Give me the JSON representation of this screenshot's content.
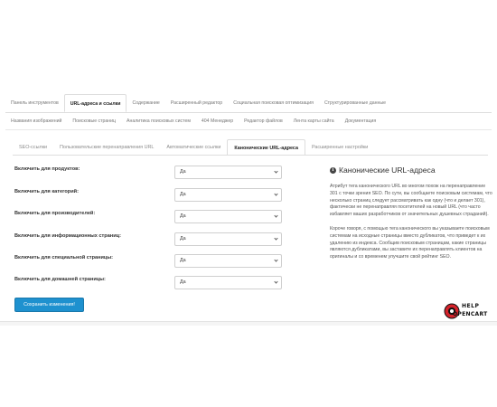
{
  "main_tabs": {
    "row1": [
      "Панель инструментов",
      "URL-адреса и ссылки",
      "Содержание",
      "Расширенный редактор",
      "Социальная поисковая оптимизация",
      "Структурированные данные"
    ],
    "row2": [
      "Названия изображений",
      "Поисковые страниц",
      "Аналитика поисковых систем",
      "404 Менеджер",
      "Редактор файлов",
      "Лента карты сайта",
      "Документация"
    ],
    "active": "URL-адреса и ссылки"
  },
  "sub_tabs": {
    "items": [
      "SEO-ссылки",
      "Пользовательские перенаправления URL",
      "Автоматические ссылки",
      "Канонические URL-адреса",
      "Расширенные настройки"
    ],
    "active": "Канонические URL-адреса"
  },
  "form": {
    "rows": [
      {
        "label": "Включить для продуктов:",
        "value": "Да"
      },
      {
        "label": "Включить для категорий:",
        "value": "Да"
      },
      {
        "label": "Включить для производителей:",
        "value": "Да"
      },
      {
        "label": "Включить для информационных страниц:",
        "value": "Да"
      },
      {
        "label": "Включить для специальной страницы:",
        "value": "Да"
      },
      {
        "label": "Включить для домашней страницы:",
        "value": "Да"
      }
    ],
    "save_label": "Сохранить изменения!"
  },
  "info": {
    "icon": "info-circle-icon",
    "title": "Канонические URL-адреса",
    "p1": "Атрибут тега канонического URL во многом похож на перенаправление 301 с точки зрения SEO. По сути, вы сообщаете поисковым системам, что несколько страниц следует рассматривать как одну (что и делает 301), фактически не перенаправляя посетителей на новый URL (что часто избавляет ваших разработчиков от значительных душевных страданий).",
    "p2": "Короче говоря, с помощью тега канонического вы указываете поисковым системам на исходные страницы вместо дубликатов, что приведет к их удалению из индекса. Сообщив поисковым страницам, какие страницы являются дубликатами, вы заставите их перенаправлять клиентов на оригиналы и со временем улучшите свой рейтинг SEO."
  },
  "logo": {
    "line1": "HELP",
    "line2": "OPENCART",
    "accent": "#d4232b"
  },
  "colors": {
    "primary_button": "#1e91cf"
  }
}
